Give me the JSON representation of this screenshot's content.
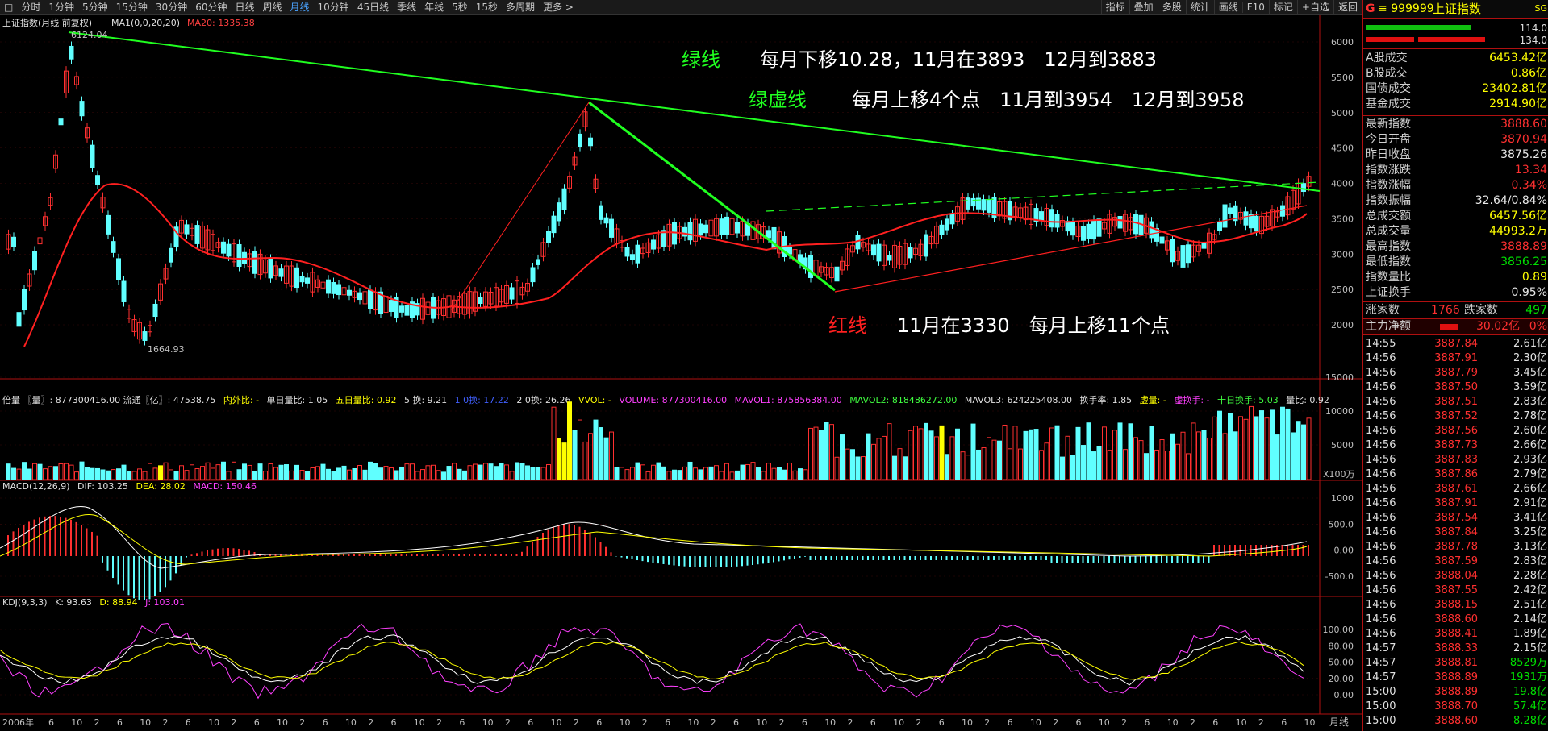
{
  "toolbar": {
    "items": [
      "分时",
      "1分钟",
      "5分钟",
      "15分钟",
      "30分钟",
      "60分钟",
      "日线",
      "周线",
      "月线",
      "10分钟",
      "45日线",
      "季线",
      "年线",
      "5秒",
      "15秒",
      "多周期",
      "更多 >"
    ],
    "active_index": 8,
    "right_items": [
      "指标",
      "叠加",
      "多股",
      "统计",
      "画线",
      "F10",
      "标记",
      "+自选",
      "返回"
    ]
  },
  "main_legend": {
    "name": "上证指数(月线 前复权)",
    "ma1": "MA1(0,0,20,20)",
    "ma20": "MA20: 1335.38"
  },
  "price_axis": [
    "6000",
    "5500",
    "5000",
    "4500",
    "4000",
    "3500",
    "3000",
    "2500",
    "2000"
  ],
  "annotations": {
    "high_label": "6124.04",
    "low_label": "1664.93",
    "green_title": "绿线",
    "green_text": "每月下移10.28，11月在3893　12月到3883",
    "green_dash_title": "绿虚线",
    "green_dash_text": "每月上移4个点　11月到3954　12月到3958",
    "red_title": "红线",
    "red_text": "11月在3330　每月上移11个点"
  },
  "volume_legend": {
    "title": "倍量 〖量〗: 877300416.00 流通〖亿〗: 47538.75",
    "nwb": "内外比: -",
    "dlb": "单日量比: 1.05",
    "wrlb": "五日量比: 0.92",
    "h5": "5 换: 9.21",
    "h1": "1 0换: 17.22",
    "h20": "2 0换: 26.26",
    "vvol": "VVOL: -",
    "volume": "VOLUME: 877300416.00",
    "mavol1": "MAVOL1: 875856384.00",
    "mavol2": "MAVOL2: 818486272.00",
    "mavol3": "MAVOL3: 624225408.00",
    "hsl": "换手率: 1.85",
    "xl": "虚量: -",
    "xhs": "虚换手: -",
    "sr": "十日换手: 5.03",
    "lb": "量比: 0.92",
    "unit": "X100万",
    "axis": [
      "15000",
      "10000",
      "5000"
    ]
  },
  "macd_legend": {
    "name": "MACD(12,26,9)",
    "dif": "DIF: 103.25",
    "dea": "DEA: 28.02",
    "macd": "MACD: 150.46",
    "axis": [
      "1000",
      "500.0",
      "0.00",
      "-500.0"
    ]
  },
  "kdj_legend": {
    "name": "KDJ(9,3,3)",
    "k": "K: 93.63",
    "d": "D: 88.94",
    "j": "J: 103.01",
    "axis": [
      "100.00",
      "80.00",
      "50.00",
      "20.00",
      "0.00"
    ]
  },
  "x_axis": {
    "year_label": "2006年",
    "period_label": "月线"
  },
  "quote": {
    "code_label": "G",
    "code": "999999",
    "name": "上证指数",
    "corner": "SG",
    "bar_top": "114.0",
    "bar_bot": "134.0",
    "rows1": [
      {
        "label": "A股成交",
        "value": "6453.42亿",
        "color": "yellow"
      },
      {
        "label": "B股成交",
        "value": "0.86亿",
        "color": "yellow"
      },
      {
        "label": "国债成交",
        "value": "23402.81亿",
        "color": "yellow"
      },
      {
        "label": "基金成交",
        "value": "2914.90亿",
        "color": "yellow"
      }
    ],
    "rows2": [
      {
        "label": "最新指数",
        "value": "3888.60",
        "color": "red"
      },
      {
        "label": "今日开盘",
        "value": "3870.94",
        "color": "red"
      },
      {
        "label": "昨日收盘",
        "value": "3875.26",
        "color": "white"
      },
      {
        "label": "指数涨跌",
        "value": "13.34",
        "color": "red"
      },
      {
        "label": "指数涨幅",
        "value": "0.34%",
        "color": "red"
      },
      {
        "label": "指数振幅",
        "value": "32.64/0.84%",
        "color": "white"
      },
      {
        "label": "总成交额",
        "value": "6457.56亿",
        "color": "yellow"
      },
      {
        "label": "总成交量",
        "value": "44993.2万",
        "color": "yellow"
      },
      {
        "label": "最高指数",
        "value": "3888.89",
        "color": "red"
      },
      {
        "label": "最低指数",
        "value": "3856.25",
        "color": "green"
      },
      {
        "label": "指数量比",
        "value": "0.89",
        "color": "yellow"
      },
      {
        "label": "上证换手",
        "value": "0.95%",
        "color": "white"
      }
    ],
    "rise_label": "涨家数",
    "rise_value": "1766",
    "fall_label": "跌家数",
    "fall_value": "497",
    "netflow_label": "主力净额",
    "netflow_value": "30.02亿",
    "netflow_pct": "0%"
  },
  "ticks": [
    {
      "t": "14:55",
      "p": "3887.84",
      "v": "2.61亿"
    },
    {
      "t": "14:56",
      "p": "3887.91",
      "v": "2.30亿"
    },
    {
      "t": "14:56",
      "p": "3887.79",
      "v": "3.45亿"
    },
    {
      "t": "14:56",
      "p": "3887.50",
      "v": "3.59亿"
    },
    {
      "t": "14:56",
      "p": "3887.51",
      "v": "2.83亿"
    },
    {
      "t": "14:56",
      "p": "3887.52",
      "v": "2.78亿"
    },
    {
      "t": "14:56",
      "p": "3887.56",
      "v": "2.60亿"
    },
    {
      "t": "14:56",
      "p": "3887.73",
      "v": "2.66亿"
    },
    {
      "t": "14:56",
      "p": "3887.83",
      "v": "2.93亿"
    },
    {
      "t": "14:56",
      "p": "3887.86",
      "v": "2.79亿"
    },
    {
      "t": "14:56",
      "p": "3887.61",
      "v": "2.66亿"
    },
    {
      "t": "14:56",
      "p": "3887.91",
      "v": "2.91亿"
    },
    {
      "t": "14:56",
      "p": "3887.54",
      "v": "3.41亿"
    },
    {
      "t": "14:56",
      "p": "3887.84",
      "v": "3.25亿"
    },
    {
      "t": "14:56",
      "p": "3887.78",
      "v": "3.13亿"
    },
    {
      "t": "14:56",
      "p": "3887.59",
      "v": "2.83亿"
    },
    {
      "t": "14:56",
      "p": "3888.04",
      "v": "2.28亿"
    },
    {
      "t": "14:56",
      "p": "3887.55",
      "v": "2.42亿"
    },
    {
      "t": "14:56",
      "p": "3888.15",
      "v": "2.51亿"
    },
    {
      "t": "14:56",
      "p": "3888.60",
      "v": "2.14亿"
    },
    {
      "t": "14:56",
      "p": "3888.41",
      "v": "1.89亿"
    },
    {
      "t": "14:57",
      "p": "3888.33",
      "v": "2.15亿"
    },
    {
      "t": "14:57",
      "p": "3888.81",
      "v": "8529万"
    },
    {
      "t": "14:57",
      "p": "3888.89",
      "v": "1931万"
    },
    {
      "t": "15:00",
      "p": "3888.89",
      "v": "19.8亿"
    },
    {
      "t": "15:00",
      "p": "3888.70",
      "v": "57.4亿"
    },
    {
      "t": "15:00",
      "p": "3888.60",
      "v": "8.28亿"
    }
  ]
}
